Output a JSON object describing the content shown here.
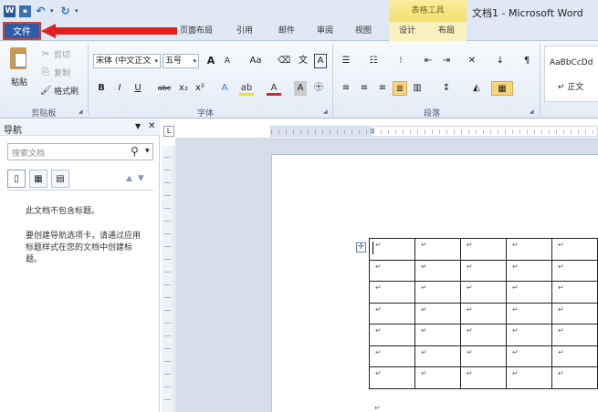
{
  "window": {
    "title": "文档1 - Microsoft Word",
    "contextual_tab_group": "表格工具"
  },
  "quick_access": {
    "word_logo": "W",
    "save_icon": "floppy-disk",
    "undo_icon": "undo-arrow",
    "redo_icon": "redo-arrow"
  },
  "tabs": {
    "file": "文件",
    "items": [
      {
        "label": "页面布局"
      },
      {
        "label": "引用"
      },
      {
        "label": "邮件"
      },
      {
        "label": "审阅"
      },
      {
        "label": "视图"
      },
      {
        "label": "设计"
      },
      {
        "label": "布局"
      }
    ]
  },
  "ribbon": {
    "clipboard": {
      "group_label": "剪贴板",
      "paste": "粘贴",
      "cut": "剪切",
      "copy": "复制",
      "format_painter": "格式刷"
    },
    "font": {
      "group_label": "字体",
      "font_name": "宋体 (中文正文",
      "font_size": "五号",
      "grow": "A",
      "shrink": "A",
      "change_case": "Aa",
      "bold": "B",
      "italic": "I",
      "underline": "U",
      "strike": "abc",
      "subscript": "x₂",
      "superscript": "x²"
    },
    "paragraph": {
      "group_label": "段落"
    },
    "styles": {
      "sample": "AaBbCcDd",
      "style_name": "↵ 正文"
    }
  },
  "navigation": {
    "title": "导航",
    "search_placeholder": "搜索文档",
    "message_1": "此文档不包含标题。",
    "message_2": "要创建导航选项卡，请通过应用标题样式在您的文档中创建标题。"
  },
  "document": {
    "table": {
      "rows": 7,
      "cols": 5,
      "cell_mark": "↵"
    },
    "after_table_mark": "↵"
  },
  "colors": {
    "file_tab": "#2a5ca8",
    "annotation_arrow": "#e02020",
    "contextual_tab": "#f5df6b"
  }
}
